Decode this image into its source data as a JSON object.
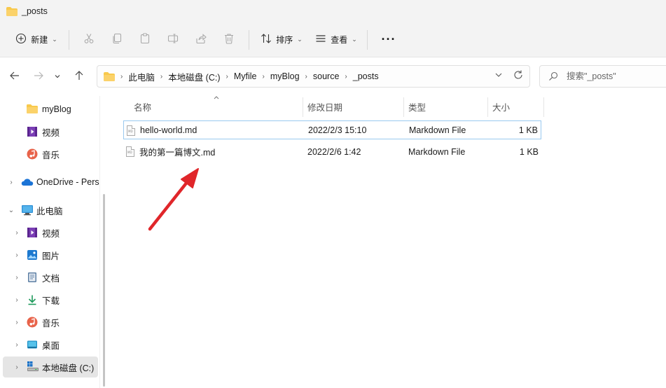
{
  "window": {
    "title": "_posts"
  },
  "toolbar": {
    "new_label": "新建",
    "sort_label": "排序",
    "view_label": "查看",
    "more_label": "···",
    "icons": [
      "cut-icon",
      "copy-icon",
      "paste-icon",
      "rename-icon",
      "share-icon",
      "delete-icon"
    ]
  },
  "address": {
    "crumbs": [
      "此电脑",
      "本地磁盘 (C:)",
      "Myfile",
      "myBlog",
      "source",
      "_posts"
    ],
    "search_placeholder": "搜索\"_posts\""
  },
  "sidebar": {
    "items": [
      {
        "label": "myBlog",
        "icon": "folder-icon"
      },
      {
        "label": "视频",
        "icon": "video-icon"
      },
      {
        "label": "音乐",
        "icon": "music-icon"
      },
      {
        "label": "OneDrive - Pers",
        "icon": "cloud-icon"
      },
      {
        "label": "此电脑",
        "icon": "computer-icon"
      },
      {
        "label": "视频",
        "icon": "video-icon"
      },
      {
        "label": "图片",
        "icon": "pictures-icon"
      },
      {
        "label": "文档",
        "icon": "document-icon"
      },
      {
        "label": "下载",
        "icon": "download-icon"
      },
      {
        "label": "音乐",
        "icon": "music-icon"
      },
      {
        "label": "桌面",
        "icon": "desktop-icon"
      },
      {
        "label": "本地磁盘 (C:)",
        "icon": "drive-icon"
      }
    ]
  },
  "files": {
    "columns": [
      "名称",
      "修改日期",
      "类型",
      "大小"
    ],
    "rows": [
      {
        "name": "hello-world.md",
        "modified": "2022/2/3 15:10",
        "type": "Markdown File",
        "size": "1 KB"
      },
      {
        "name": "我的第一篇博文.md",
        "modified": "2022/2/6 1:42",
        "type": "Markdown File",
        "size": "1 KB"
      }
    ]
  },
  "colors": {
    "accent": "#0067c0",
    "annotation_arrow": "#e0262a",
    "folder": "#f8c94c"
  }
}
